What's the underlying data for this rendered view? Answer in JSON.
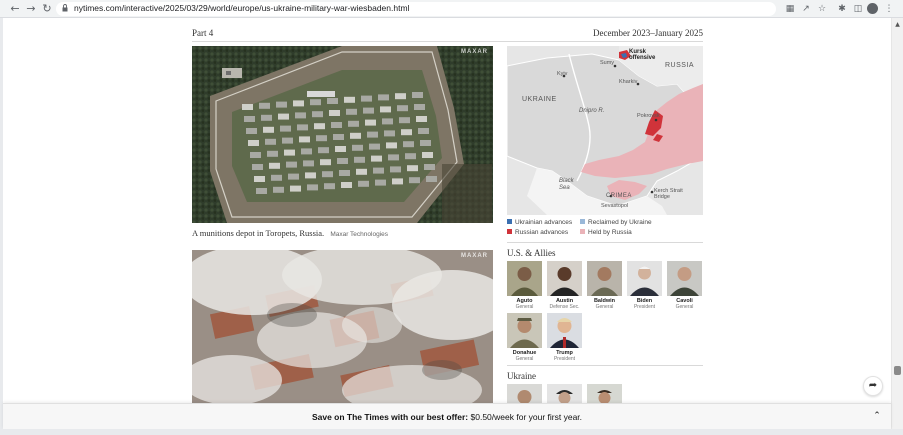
{
  "browser": {
    "url": "nytimes.com/interactive/2025/03/29/world/europe/us-ukraine-military-war-wiesbaden.html",
    "back_icon": "arrow-left-icon",
    "forward_icon": "arrow-right-icon",
    "reload_icon": "reload-icon"
  },
  "article": {
    "part_label": "Part 4",
    "date_range": "December 2023–January 2025",
    "image1": {
      "watermark": "MAXAR",
      "caption": "A munitions depot in Toropets, Russia.",
      "credit": "Maxar Technologies"
    },
    "image2": {
      "watermark": "MAXAR"
    }
  },
  "map": {
    "labels": {
      "kursk": "Kursk offensive",
      "sumy": "Sumy",
      "russia": "RUSSIA",
      "kyiv": "Kyiv",
      "kharkiv": "Kharkiv",
      "ukraine": "UKRAINE",
      "dnipro": "Dnipro R.",
      "pokrovsk": "Pokrovsk",
      "black_sea": "Black Sea",
      "crimea": "CRIMEA",
      "kerch": "Kerch Strait Bridge",
      "sevastopol": "Sevastopol"
    },
    "legend": [
      {
        "label": "Ukrainian advances",
        "color": "#3a6fb0"
      },
      {
        "label": "Reclaimed by Ukraine",
        "color": "#9ab8d8"
      },
      {
        "label": "Russian advances",
        "color": "#d0333a"
      },
      {
        "label": "Held by Russia",
        "color": "#eab3b8"
      }
    ]
  },
  "us_allies": {
    "heading": "U.S. & Allies",
    "people": [
      {
        "name": "Aguto",
        "role": "General"
      },
      {
        "name": "Austin",
        "role": "Defense Sec."
      },
      {
        "name": "Baldwin",
        "role": "General"
      },
      {
        "name": "Biden",
        "role": "President"
      },
      {
        "name": "Cavoli",
        "role": "General"
      },
      {
        "name": "Donahue",
        "role": "General"
      },
      {
        "name": "Trump",
        "role": "President"
      }
    ]
  },
  "ukraine": {
    "heading": "Ukraine"
  },
  "offer_bar": {
    "lead": "Save on The Times with our best offer:",
    "price": "$0.50",
    "rest": "/week for your first year."
  }
}
